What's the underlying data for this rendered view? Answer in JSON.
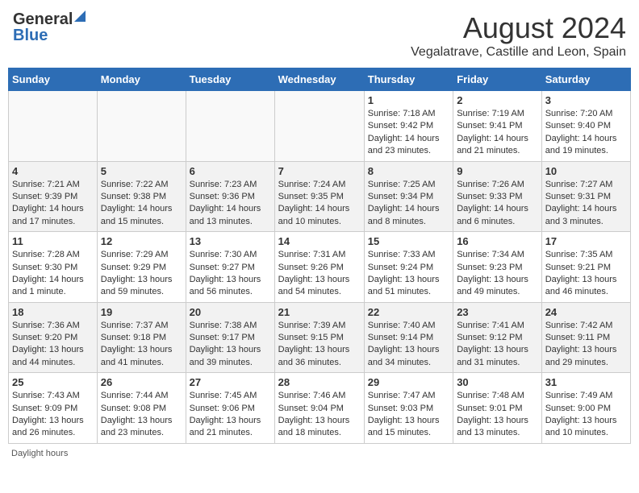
{
  "header": {
    "logo_general": "General",
    "logo_blue": "Blue",
    "title": "August 2024",
    "subtitle": "Vegalatrave, Castille and Leon, Spain"
  },
  "weekdays": [
    "Sunday",
    "Monday",
    "Tuesday",
    "Wednesday",
    "Thursday",
    "Friday",
    "Saturday"
  ],
  "weeks": [
    [
      {
        "day": "",
        "info": ""
      },
      {
        "day": "",
        "info": ""
      },
      {
        "day": "",
        "info": ""
      },
      {
        "day": "",
        "info": ""
      },
      {
        "day": "1",
        "info": "Sunrise: 7:18 AM\nSunset: 9:42 PM\nDaylight: 14 hours and 23 minutes."
      },
      {
        "day": "2",
        "info": "Sunrise: 7:19 AM\nSunset: 9:41 PM\nDaylight: 14 hours and 21 minutes."
      },
      {
        "day": "3",
        "info": "Sunrise: 7:20 AM\nSunset: 9:40 PM\nDaylight: 14 hours and 19 minutes."
      }
    ],
    [
      {
        "day": "4",
        "info": "Sunrise: 7:21 AM\nSunset: 9:39 PM\nDaylight: 14 hours and 17 minutes."
      },
      {
        "day": "5",
        "info": "Sunrise: 7:22 AM\nSunset: 9:38 PM\nDaylight: 14 hours and 15 minutes."
      },
      {
        "day": "6",
        "info": "Sunrise: 7:23 AM\nSunset: 9:36 PM\nDaylight: 14 hours and 13 minutes."
      },
      {
        "day": "7",
        "info": "Sunrise: 7:24 AM\nSunset: 9:35 PM\nDaylight: 14 hours and 10 minutes."
      },
      {
        "day": "8",
        "info": "Sunrise: 7:25 AM\nSunset: 9:34 PM\nDaylight: 14 hours and 8 minutes."
      },
      {
        "day": "9",
        "info": "Sunrise: 7:26 AM\nSunset: 9:33 PM\nDaylight: 14 hours and 6 minutes."
      },
      {
        "day": "10",
        "info": "Sunrise: 7:27 AM\nSunset: 9:31 PM\nDaylight: 14 hours and 3 minutes."
      }
    ],
    [
      {
        "day": "11",
        "info": "Sunrise: 7:28 AM\nSunset: 9:30 PM\nDaylight: 14 hours and 1 minute."
      },
      {
        "day": "12",
        "info": "Sunrise: 7:29 AM\nSunset: 9:29 PM\nDaylight: 13 hours and 59 minutes."
      },
      {
        "day": "13",
        "info": "Sunrise: 7:30 AM\nSunset: 9:27 PM\nDaylight: 13 hours and 56 minutes."
      },
      {
        "day": "14",
        "info": "Sunrise: 7:31 AM\nSunset: 9:26 PM\nDaylight: 13 hours and 54 minutes."
      },
      {
        "day": "15",
        "info": "Sunrise: 7:33 AM\nSunset: 9:24 PM\nDaylight: 13 hours and 51 minutes."
      },
      {
        "day": "16",
        "info": "Sunrise: 7:34 AM\nSunset: 9:23 PM\nDaylight: 13 hours and 49 minutes."
      },
      {
        "day": "17",
        "info": "Sunrise: 7:35 AM\nSunset: 9:21 PM\nDaylight: 13 hours and 46 minutes."
      }
    ],
    [
      {
        "day": "18",
        "info": "Sunrise: 7:36 AM\nSunset: 9:20 PM\nDaylight: 13 hours and 44 minutes."
      },
      {
        "day": "19",
        "info": "Sunrise: 7:37 AM\nSunset: 9:18 PM\nDaylight: 13 hours and 41 minutes."
      },
      {
        "day": "20",
        "info": "Sunrise: 7:38 AM\nSunset: 9:17 PM\nDaylight: 13 hours and 39 minutes."
      },
      {
        "day": "21",
        "info": "Sunrise: 7:39 AM\nSunset: 9:15 PM\nDaylight: 13 hours and 36 minutes."
      },
      {
        "day": "22",
        "info": "Sunrise: 7:40 AM\nSunset: 9:14 PM\nDaylight: 13 hours and 34 minutes."
      },
      {
        "day": "23",
        "info": "Sunrise: 7:41 AM\nSunset: 9:12 PM\nDaylight: 13 hours and 31 minutes."
      },
      {
        "day": "24",
        "info": "Sunrise: 7:42 AM\nSunset: 9:11 PM\nDaylight: 13 hours and 29 minutes."
      }
    ],
    [
      {
        "day": "25",
        "info": "Sunrise: 7:43 AM\nSunset: 9:09 PM\nDaylight: 13 hours and 26 minutes."
      },
      {
        "day": "26",
        "info": "Sunrise: 7:44 AM\nSunset: 9:08 PM\nDaylight: 13 hours and 23 minutes."
      },
      {
        "day": "27",
        "info": "Sunrise: 7:45 AM\nSunset: 9:06 PM\nDaylight: 13 hours and 21 minutes."
      },
      {
        "day": "28",
        "info": "Sunrise: 7:46 AM\nSunset: 9:04 PM\nDaylight: 13 hours and 18 minutes."
      },
      {
        "day": "29",
        "info": "Sunrise: 7:47 AM\nSunset: 9:03 PM\nDaylight: 13 hours and 15 minutes."
      },
      {
        "day": "30",
        "info": "Sunrise: 7:48 AM\nSunset: 9:01 PM\nDaylight: 13 hours and 13 minutes."
      },
      {
        "day": "31",
        "info": "Sunrise: 7:49 AM\nSunset: 9:00 PM\nDaylight: 13 hours and 10 minutes."
      }
    ]
  ],
  "footer": {
    "daylight_label": "Daylight hours"
  }
}
